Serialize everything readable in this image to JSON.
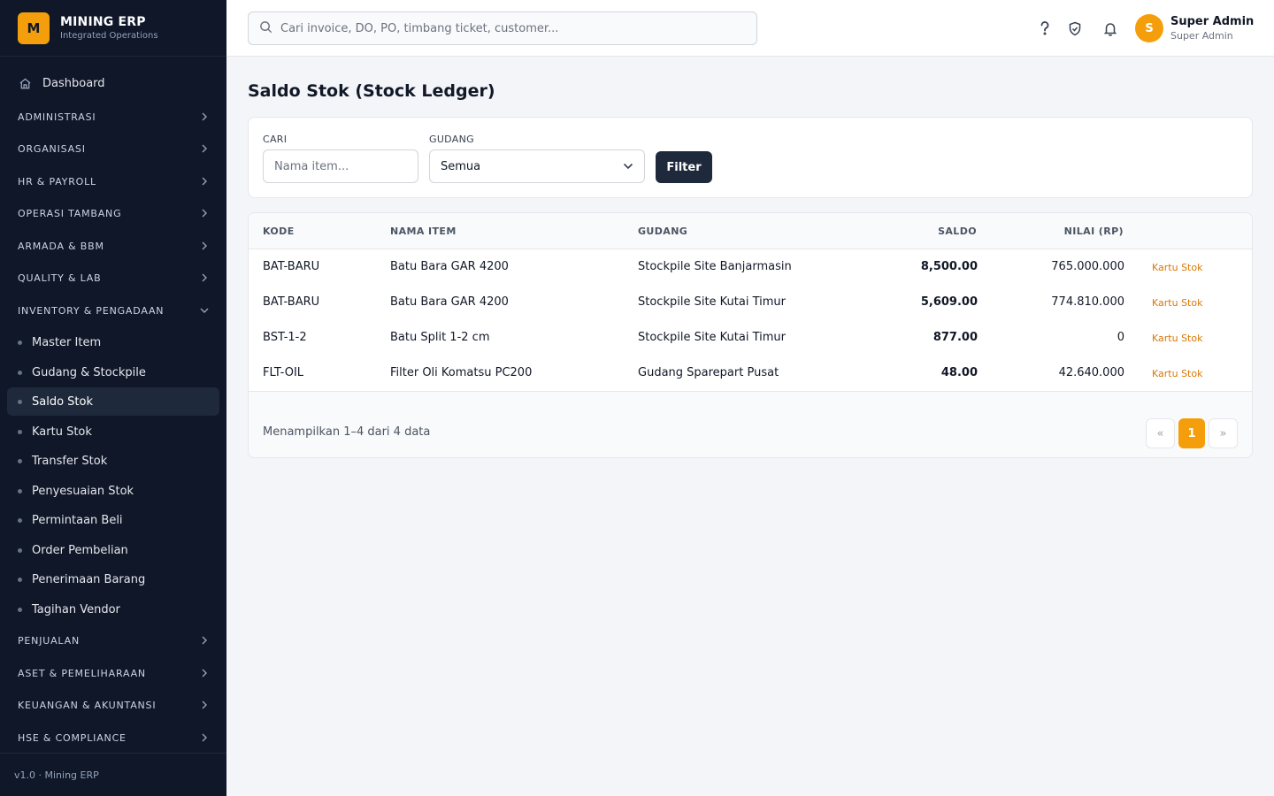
{
  "brand": {
    "logo_letter": "M",
    "name": "MINING ERP",
    "subtitle": "Integrated Operations"
  },
  "sidebar": {
    "dashboard": {
      "label": "Dashboard",
      "icon": "home-icon"
    },
    "groups": [
      {
        "label": "ADMINISTRASI"
      },
      {
        "label": "ORGANISASI"
      },
      {
        "label": "HR & PAYROLL"
      },
      {
        "label": "OPERASI TAMBANG"
      },
      {
        "label": "ARMADA & BBM"
      },
      {
        "label": "QUALITY & LAB"
      },
      {
        "label": "INVENTORY & PENGADAAN",
        "expanded": true
      },
      {
        "label": "PENJUALAN"
      },
      {
        "label": "ASET & PEMELIHARAAN"
      },
      {
        "label": "KEUANGAN & AKUNTANSI"
      },
      {
        "label": "HSE & COMPLIANCE"
      }
    ],
    "inventory_items": [
      {
        "label": "Master Item"
      },
      {
        "label": "Gudang & Stockpile"
      },
      {
        "label": "Saldo Stok",
        "active": true
      },
      {
        "label": "Kartu Stok"
      },
      {
        "label": "Transfer Stok"
      },
      {
        "label": "Penyesuaian Stok"
      },
      {
        "label": "Permintaan Beli"
      },
      {
        "label": "Order Pembelian"
      },
      {
        "label": "Penerimaan Barang"
      },
      {
        "label": "Tagihan Vendor"
      }
    ],
    "footer": "v1.0 · Mining ERP"
  },
  "header": {
    "search_placeholder": "Cari invoice, DO, PO, timbang ticket, customer...",
    "icons": [
      "help-icon",
      "shield-check-icon",
      "bell-icon"
    ],
    "user": {
      "avatar_letter": "S",
      "name": "Super Admin",
      "role": "Super Admin"
    }
  },
  "page": {
    "title": "Saldo Stok (Stock Ledger)",
    "filter": {
      "search_label": "CARI",
      "search_placeholder": "Nama item...",
      "search_value": "",
      "warehouse_label": "GUDANG",
      "warehouse_value": "Semua",
      "button_label": "Filter"
    },
    "table": {
      "columns": [
        "KODE",
        "NAMA ITEM",
        "GUDANG",
        "SALDO",
        "NILAI (RP)"
      ],
      "rows": [
        {
          "kode": "BAT-BARU",
          "nama": "Batu Bara GAR 4200",
          "gudang": "Stockpile Site Banjarmasin",
          "saldo": "8,500.00",
          "nilai": "765.000.000",
          "action": "Kartu Stok"
        },
        {
          "kode": "BAT-BARU",
          "nama": "Batu Bara GAR 4200",
          "gudang": "Stockpile Site Kutai Timur",
          "saldo": "5,609.00",
          "nilai": "774.810.000",
          "action": "Kartu Stok"
        },
        {
          "kode": "BST-1-2",
          "nama": "Batu Split 1-2 cm",
          "gudang": "Stockpile Site Kutai Timur",
          "saldo": "877.00",
          "nilai": "0",
          "action": "Kartu Stok"
        },
        {
          "kode": "FLT-OIL",
          "nama": "Filter Oli Komatsu PC200",
          "gudang": "Gudang Sparepart Pusat",
          "saldo": "48.00",
          "nilai": "42.640.000",
          "action": "Kartu Stok"
        }
      ]
    },
    "pagination": {
      "summary": "Menampilkan 1–4 dari 4 data",
      "prev": "«",
      "current": "1",
      "next": "»"
    }
  },
  "colors": {
    "sidebar_bg": "#0f1729",
    "accent": "#f59e0b",
    "link": "#d97706",
    "button_dark": "#1e293b"
  }
}
